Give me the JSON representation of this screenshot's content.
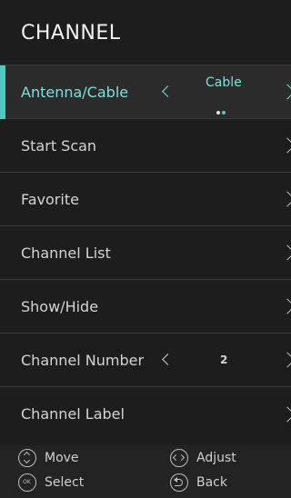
{
  "header": {
    "title": "CHANNEL"
  },
  "menu": {
    "items": [
      {
        "label": "Antenna/Cable",
        "value": "Cable",
        "selected": true
      },
      {
        "label": "Start Scan"
      },
      {
        "label": "Favorite"
      },
      {
        "label": "Channel List"
      },
      {
        "label": "Show/Hide"
      },
      {
        "label": "Channel Number",
        "value": "2"
      },
      {
        "label": "Channel Label"
      }
    ]
  },
  "selector": {
    "option_count": 2,
    "active_index": 1
  },
  "footer": {
    "move": {
      "label": "Move",
      "icon": "up-down-circle-icon"
    },
    "adjust": {
      "label": "Adjust",
      "icon": "left-right-circle-icon"
    },
    "select": {
      "label": "Select",
      "icon": "ok-circle-icon",
      "icon_text": "OK"
    },
    "back": {
      "label": "Back",
      "icon": "back-circle-icon"
    }
  },
  "colors": {
    "accent": "#4ec9c0",
    "accent_text": "#7fe0da",
    "background": "#1d1d1d",
    "divider": "#3a3a3a"
  }
}
